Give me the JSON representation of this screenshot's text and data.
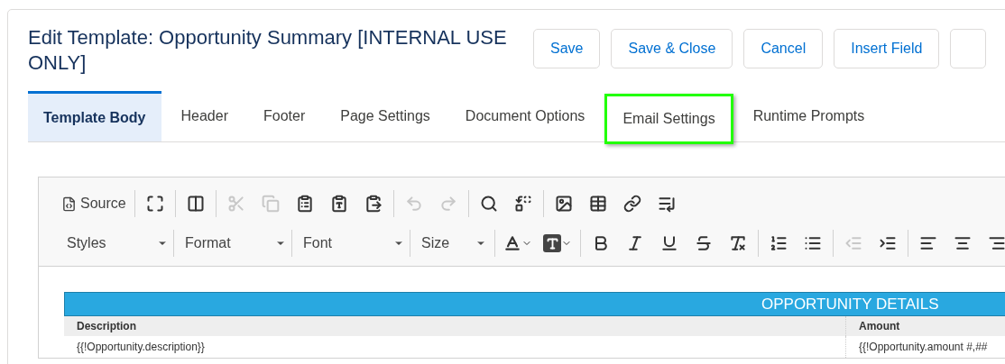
{
  "title": "Edit Template: Opportunity Summary [INTERNAL USE ONLY]",
  "buttons": [
    "Save",
    "Save & Close",
    "Cancel",
    "Insert Field"
  ],
  "tabs": [
    {
      "label": "Template Body",
      "selected": true,
      "highlighted": false
    },
    {
      "label": "Header",
      "selected": false,
      "highlighted": false
    },
    {
      "label": "Footer",
      "selected": false,
      "highlighted": false
    },
    {
      "label": "Page Settings",
      "selected": false,
      "highlighted": false
    },
    {
      "label": "Document Options",
      "selected": false,
      "highlighted": false
    },
    {
      "label": "Email Settings",
      "selected": false,
      "highlighted": true
    },
    {
      "label": "Runtime Prompts",
      "selected": false,
      "highlighted": false
    }
  ],
  "toolbar": {
    "rows": [
      {
        "groups": [
          [
            {
              "kind": "labeled",
              "label": "Source",
              "disabled": false
            }
          ],
          [
            {
              "kind": "icon",
              "disabled": false
            }
          ],
          [
            {
              "kind": "icon",
              "disabled": false
            }
          ],
          [
            {
              "kind": "icon",
              "disabled": true
            },
            {
              "kind": "icon",
              "disabled": true
            },
            {
              "kind": "icon",
              "disabled": false
            },
            {
              "kind": "icon",
              "disabled": false
            },
            {
              "kind": "icon",
              "disabled": false
            }
          ],
          [
            {
              "kind": "icon",
              "disabled": true
            },
            {
              "kind": "icon",
              "disabled": true
            }
          ],
          [
            {
              "kind": "icon",
              "disabled": false
            },
            {
              "kind": "icon",
              "disabled": false
            }
          ],
          [
            {
              "kind": "icon",
              "disabled": false
            },
            {
              "kind": "icon",
              "disabled": false
            },
            {
              "kind": "icon",
              "disabled": false
            },
            {
              "kind": "icon",
              "disabled": false
            }
          ]
        ]
      },
      {
        "groups": [
          [
            {
              "kind": "combo",
              "label": "Styles"
            },
            {
              "kind": "combo",
              "label": "Format"
            },
            {
              "kind": "combo",
              "label": "Font"
            },
            {
              "kind": "combo",
              "label": "Size"
            }
          ],
          [
            {
              "kind": "color",
              "disabled": false
            },
            {
              "kind": "color",
              "disabled": false
            }
          ],
          [
            {
              "kind": "icon",
              "disabled": false
            },
            {
              "kind": "icon",
              "disabled": false
            },
            {
              "kind": "icon",
              "disabled": false
            },
            {
              "kind": "icon",
              "disabled": false
            },
            {
              "kind": "icon",
              "disabled": false
            }
          ],
          [
            {
              "kind": "icon",
              "disabled": false
            },
            {
              "kind": "icon",
              "disabled": false
            }
          ],
          [
            {
              "kind": "icon",
              "disabled": true
            },
            {
              "kind": "icon",
              "disabled": false
            }
          ],
          [
            {
              "kind": "icon",
              "disabled": false
            },
            {
              "kind": "icon",
              "disabled": false
            },
            {
              "kind": "icon",
              "disabled": false
            }
          ]
        ]
      }
    ]
  },
  "table": {
    "title": "OPPORTUNITY DETAILS",
    "columns": [
      "Description",
      "Amount"
    ],
    "rows": [
      [
        "{{!Opportunity.description}}",
        "{{!Opportunity.amount #,##"
      ]
    ]
  }
}
